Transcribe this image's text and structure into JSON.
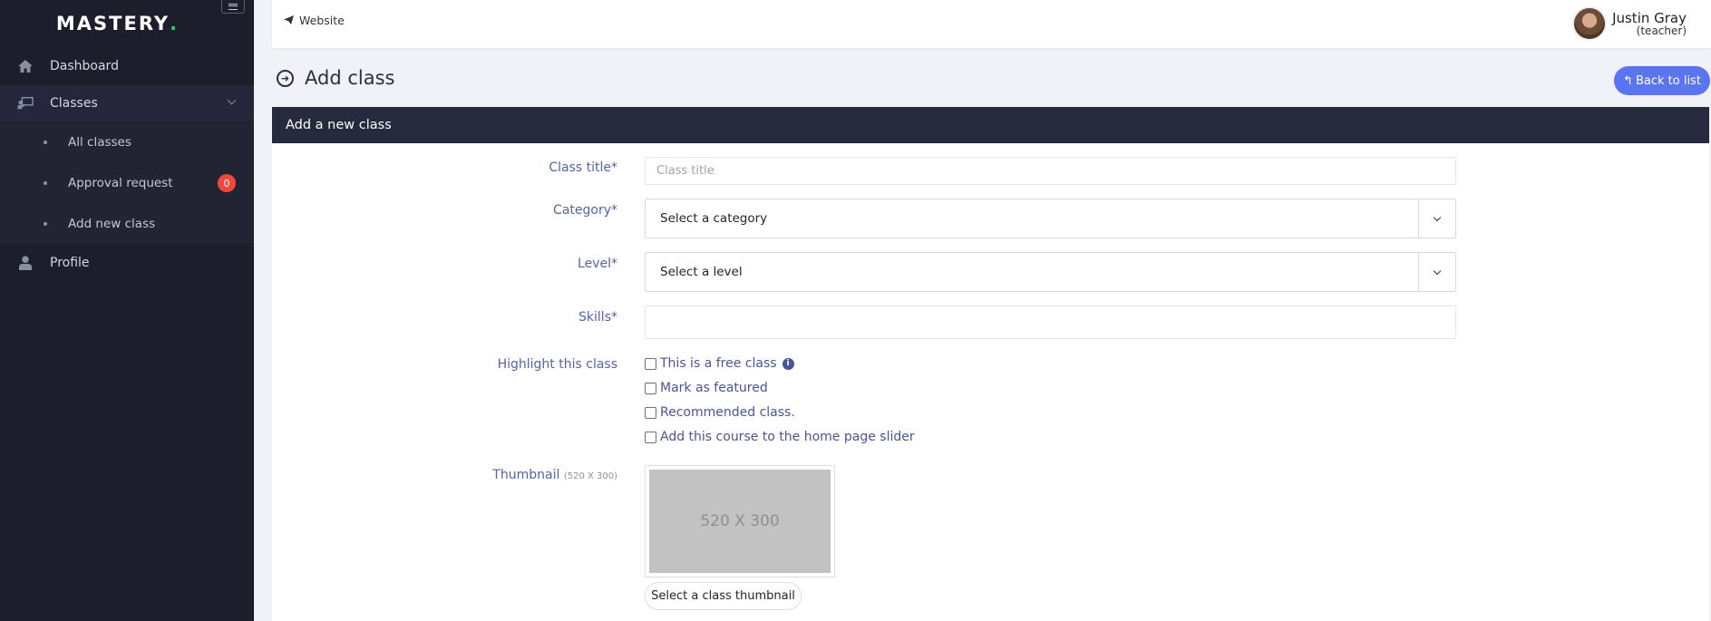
{
  "sidebar": {
    "logo": "MASTERY",
    "logo_dot": ".",
    "items": {
      "dashboard": "Dashboard",
      "classes": "Classes",
      "profile": "Profile"
    },
    "submenu": {
      "all_classes": "All classes",
      "approval_request": "Approval request",
      "approval_count": "0",
      "add_new_class": "Add new class"
    }
  },
  "topbar": {
    "website_link": "Website",
    "user_name": "Justin Gray",
    "user_role": "(teacher)"
  },
  "header": {
    "title": "Add class",
    "back_button": "Back to list"
  },
  "form": {
    "card_title": "Add a new class",
    "class_title_label": "Class title*",
    "class_title_placeholder": "Class title",
    "category_label": "Category*",
    "category_value": "Select a category",
    "level_label": "Level*",
    "level_value": "Select a level",
    "skills_label": "Skills*",
    "skills_value": "",
    "highlight_label": "Highlight this class",
    "checkboxes": {
      "free": "This is a free class",
      "featured": "Mark as featured",
      "recommended": "Recommended class.",
      "slider": "Add this course to the home page slider"
    },
    "thumbnail_label": "Thumbnail",
    "thumbnail_size_hint": "(520 X 300)",
    "thumbnail_placeholder": "520 X 300",
    "thumbnail_button": "Select a class thumbnail"
  },
  "colors": {
    "sidebar_bg": "#1d1e2c",
    "accent": "#5a74f2",
    "badge": "#f0483e",
    "label": "#5563a6"
  }
}
